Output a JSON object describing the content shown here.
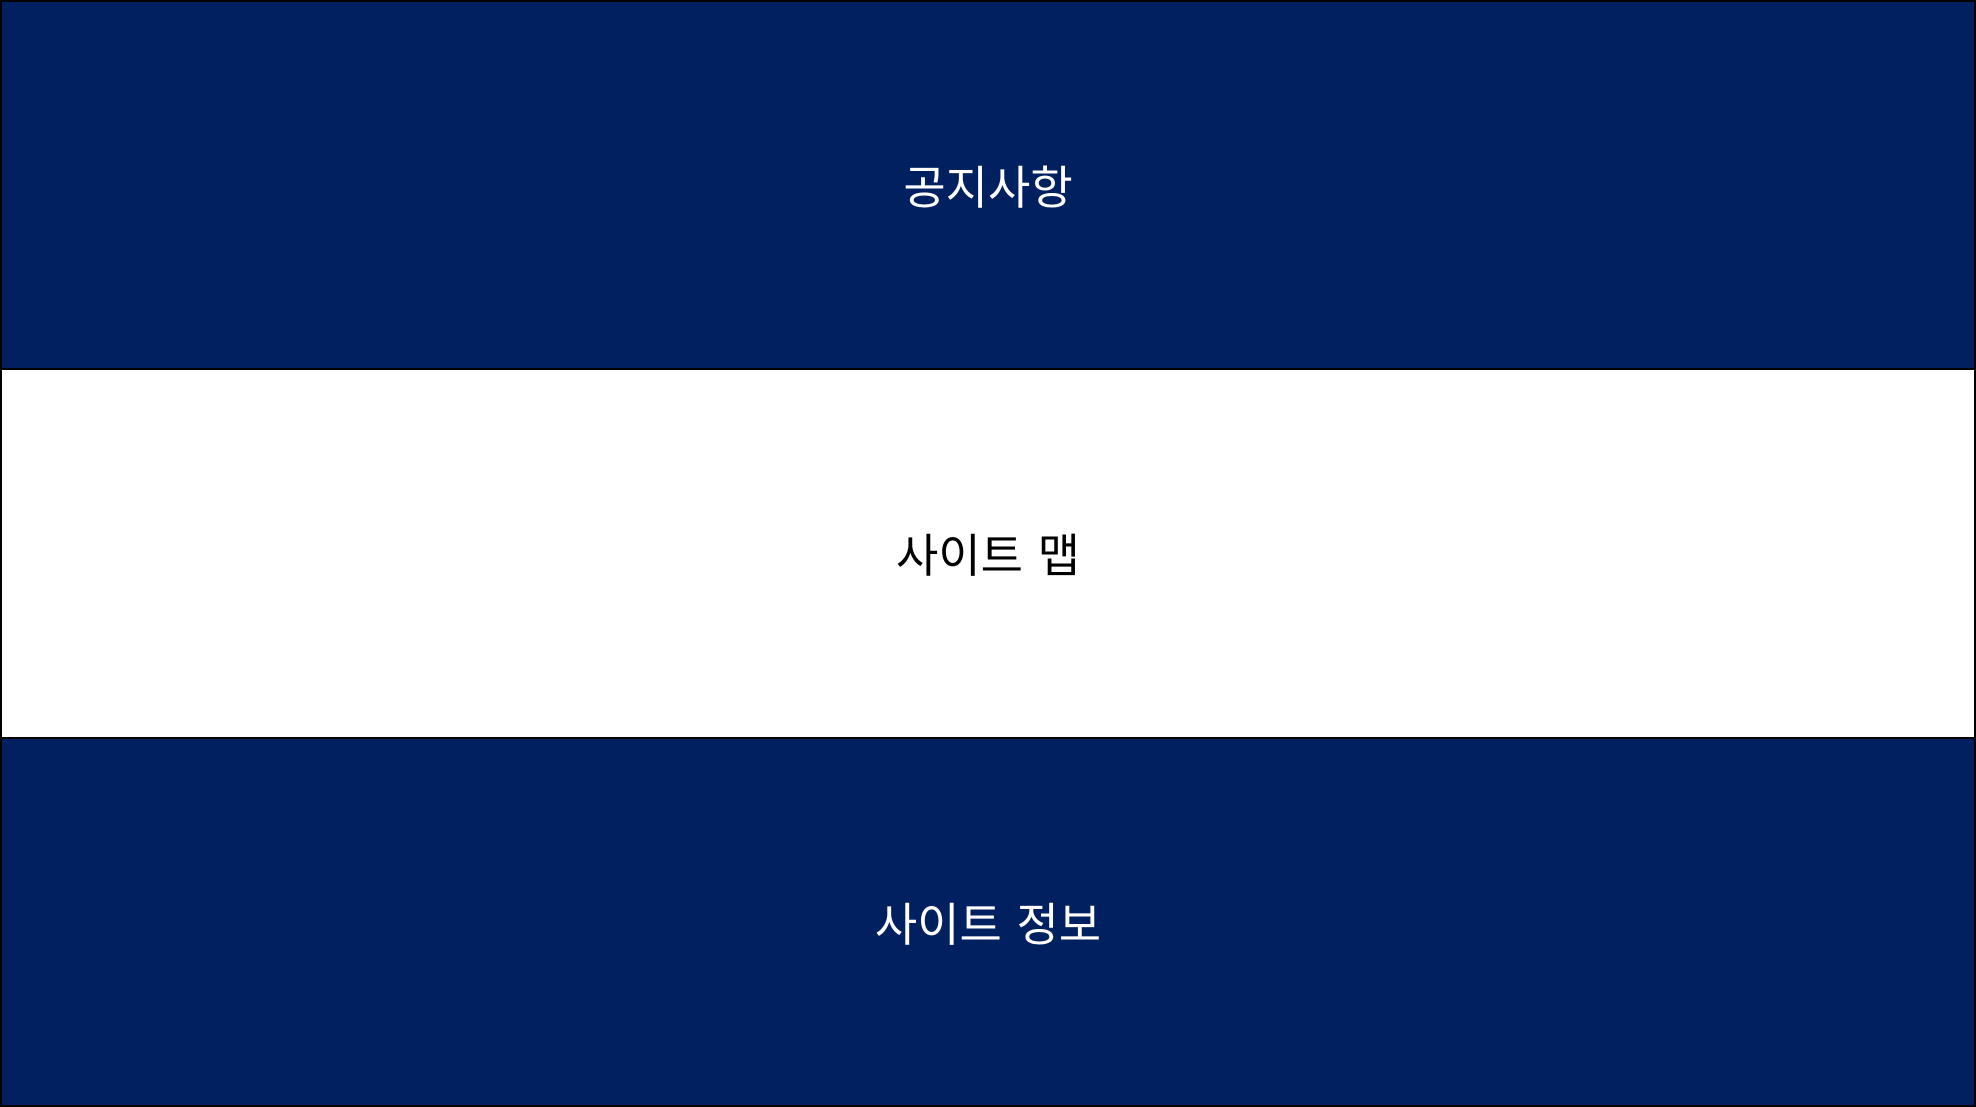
{
  "menu": {
    "items": [
      {
        "label": "공지사항"
      },
      {
        "label": "사이트 맵"
      },
      {
        "label": "사이트 정보"
      }
    ]
  },
  "colors": {
    "dark_background": "#002060",
    "light_background": "#ffffff",
    "dark_text": "#ffffff",
    "light_text": "#000000",
    "border": "#000000"
  }
}
